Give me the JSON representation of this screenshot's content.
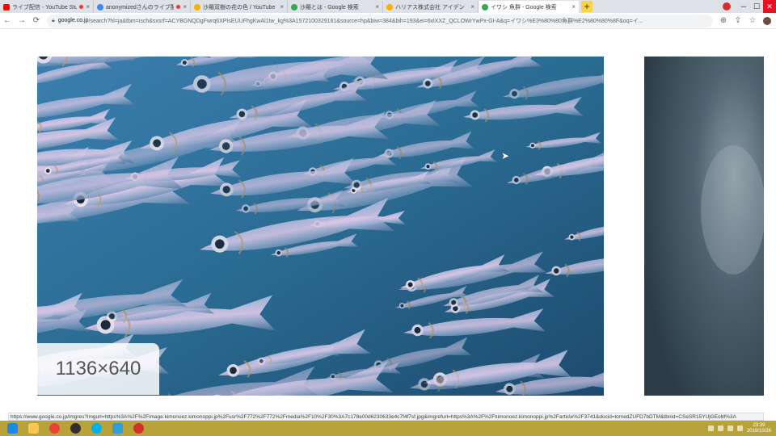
{
  "browser": {
    "tabs": [
      {
        "label": "ライブ配信 - YouTube Studio",
        "favicon": "youtube-icon",
        "color": "#ff0000",
        "recording": true,
        "active": false
      },
      {
        "label": "anonymizedさんのライブ配信",
        "favicon": "globe-icon",
        "color": "#4285f4",
        "recording": true,
        "active": false
      },
      {
        "label": "沙羅双樹の花の色 / YouTube",
        "favicon": "page-icon",
        "color": "#f4b400",
        "recording": false,
        "active": false
      },
      {
        "label": "沙羅とは - Google 検索",
        "favicon": "google-icon",
        "color": "#34a853",
        "recording": false,
        "active": false
      },
      {
        "label": "ハリアス株式会社 アイデン",
        "favicon": "page-icon",
        "color": "#f4b400",
        "recording": false,
        "active": false
      },
      {
        "label": "イワシ 魚群 - Google 検索",
        "favicon": "google-icon",
        "color": "#34a853",
        "recording": false,
        "active": true
      }
    ],
    "new_tab": "+",
    "window_controls": {
      "minimize": "─",
      "maximize": "☐",
      "close": "✕"
    },
    "nav": {
      "back": "←",
      "forward": "→",
      "reload": "⟳"
    },
    "address": {
      "host": "google.co.jp",
      "path": "/search?hl=ja&tbm=isch&sxsrf=ACYBGNQDgFwrq6XPIsEUUFhgKwAl1tw_kg%3A1572100329181&source=hp&biw=384&bih=193&ei=6vlXXZ_QCLOWrYwPx-GI-A&q=イワシ%E3%80%80魚群%E2%80%80%8F&oq=イ..."
    },
    "toolbar_icons": [
      "zoom-icon",
      "share-icon",
      "star-icon"
    ]
  },
  "preview": {
    "dimensions": "1136×640"
  },
  "status_url": "https://www.google.co.jp/imgres?imgurl=https%3A%2F%2Fimage.kimonoez.kimonoppi.jp%2Fusr%2F772%2F772%2Fmedia%2F10%2F30%3A7c178e00d6230633e4c7f4f7sf.jpg&imgrefurl=https%3A%2F%2Fkimonoez.kimonoppi.jp%2Farticle%2F3741&docid=lomedZUFD7bDTM&tbnid=CSeSR15YUjGEoM%3A",
  "taskbar": {
    "apps": [
      {
        "name": "internet-explorer-icon",
        "color": "#1e88e5"
      },
      {
        "name": "file-explorer-icon",
        "color": "#f9c74f"
      },
      {
        "name": "chrome-icon",
        "color": "#ea4335"
      },
      {
        "name": "obs-icon",
        "color": "#302e31"
      },
      {
        "name": "skype-icon",
        "color": "#00aff0"
      },
      {
        "name": "store-icon",
        "color": "#2d9fd9"
      },
      {
        "name": "app-icon",
        "color": "#d32f2f"
      }
    ],
    "clock_time": "23:39",
    "clock_date": "2019/10/26"
  },
  "colors": {
    "taskbar": "#b8a23a",
    "tabstrip": "#dee1e6",
    "water": "#27557b"
  }
}
